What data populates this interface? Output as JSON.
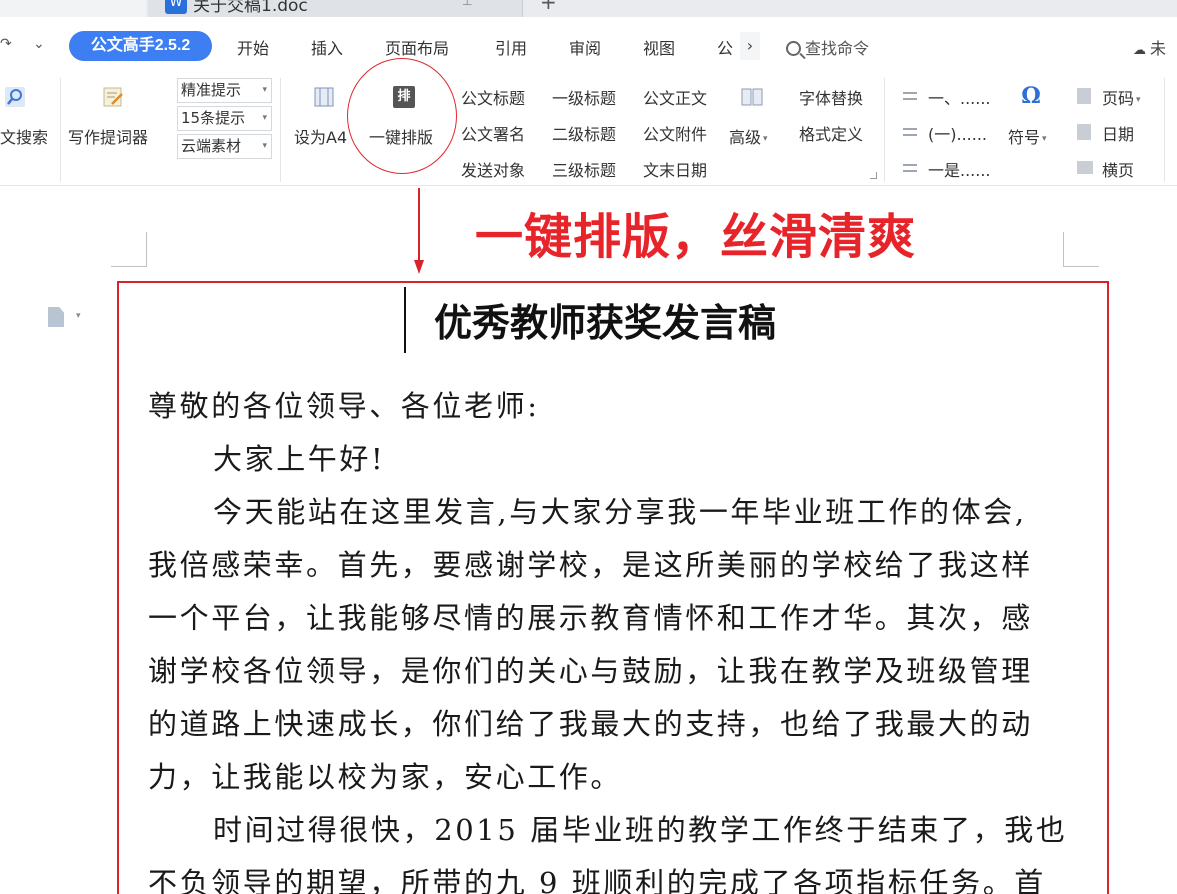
{
  "tabs": {
    "active_title": "关于交稿1.doc"
  },
  "menu": {
    "brand": "公文高手2.5.2",
    "items": [
      "开始",
      "插入",
      "页面布局",
      "引用",
      "审阅",
      "视图",
      "公"
    ],
    "search_label": "查找命令",
    "sync_label": "未"
  },
  "ribbon": {
    "search_label": "文搜索",
    "writing_prompter": "写作提词器",
    "combos": [
      "精准提示",
      "15条提示",
      "云端素材"
    ],
    "set_a4": "设为A4",
    "one_click_icon": "排",
    "one_click": "一键排版",
    "styles": {
      "col1": [
        "公文标题",
        "公文署名",
        "发送对象"
      ],
      "col2": [
        "一级标题",
        "二级标题",
        "三级标题"
      ],
      "col3": [
        "公文正文",
        "公文附件",
        "文末日期"
      ]
    },
    "advanced": "高级",
    "font_replace": "字体替换",
    "format_define": "格式定义",
    "numbering": [
      "一、......",
      "(一)......",
      "一是......"
    ],
    "symbol": "符号",
    "page_num": "页码",
    "date": "日期",
    "landscape": "横页"
  },
  "annotation": {
    "text": "一键排版，丝滑清爽",
    "color": "#e8242b"
  },
  "document": {
    "title": "优秀教师获奖发言稿",
    "lines": [
      "尊敬的各位领导、各位老师:",
      "大家上午好!",
      "今天能站在这里发言,与大家分享我一年毕业班工作的体会,",
      "我倍感荣幸。首先，要感谢学校，是这所美丽的学校给了我这样",
      "一个平台，让我能够尽情的展示教育情怀和工作才华。其次，感",
      "谢学校各位领导，是你们的关心与鼓励，让我在教学及班级管理",
      "的道路上快速成长，你们给了我最大的支持，也给了我最大的动",
      "力，让我能以校为家，安心工作。",
      "时间过得很快，2015 届毕业班的教学工作终于结束了，我也",
      "不负领导的期望，所带的九 9 班顺利的完成了各项指标任务。首"
    ]
  },
  "colors": {
    "brand_blue": "#3d7ef2",
    "annotation_red": "#d9232a"
  }
}
